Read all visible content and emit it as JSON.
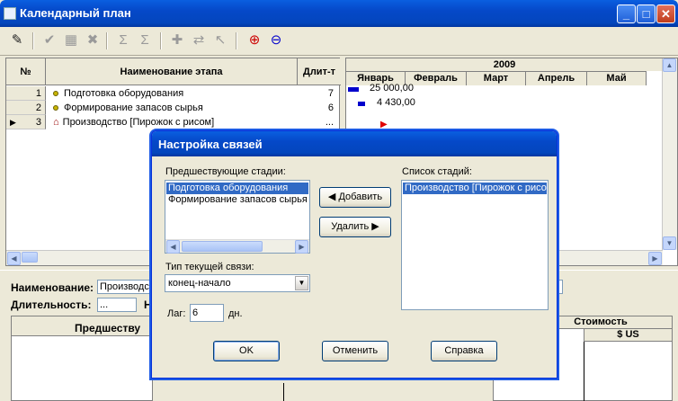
{
  "window": {
    "title": "Календарный план"
  },
  "grid": {
    "headers": {
      "num": "№",
      "name": "Наименование этапа",
      "duration": "Длит-т"
    },
    "rows": [
      {
        "num": "1",
        "name": "Подготовка оборудования",
        "duration": "7"
      },
      {
        "num": "2",
        "name": "Формирование запасов сырья",
        "duration": "6"
      },
      {
        "num": "3",
        "name": "Производство [Пирожок с рисом]",
        "duration": "..."
      }
    ]
  },
  "gantt": {
    "year": "2009",
    "months": [
      "Январь",
      "Февраль",
      "Март",
      "Апрель",
      "Май"
    ],
    "bars": [
      {
        "label": "25  000,00",
        "start": 0.0,
        "length": 0.15
      },
      {
        "label": "4  430,00",
        "start": 0.15,
        "length": 0.2
      }
    ]
  },
  "bottom": {
    "name_label": "Наименование:",
    "name_value": "Производство",
    "duration_label": "Длительность:",
    "duration_value": "...",
    "n_label": "Н",
    "predecessors_header": "Предшеству",
    "cost_header": "Стоимость",
    "currency": "$ US"
  },
  "dialog": {
    "title": "Настройка связей",
    "prev_label": "Предшествующие стадии:",
    "prev_items": [
      "Подготовка оборудования",
      "Формирование запасов сырья"
    ],
    "stages_label": "Список стадий:",
    "stages_items": [
      "Производство [Пирожок с рисо"
    ],
    "add_button": "Добавить",
    "remove_button": "Удалить",
    "link_type_label": "Тип текущей связи:",
    "link_type_value": "конец-начало",
    "lag_label": "Лаг:",
    "lag_value": "6",
    "lag_unit": "дн.",
    "ok_button": "OK",
    "cancel_button": "Отменить",
    "help_button": "Справка"
  }
}
